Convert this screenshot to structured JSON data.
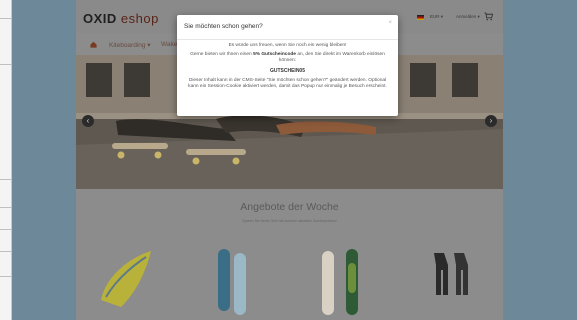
{
  "header": {
    "logo_left": "OXID",
    "logo_right": "eshop",
    "currency": "EUR",
    "account": "Anmelden"
  },
  "nav": {
    "items": [
      "Kiteboarding",
      "Wakeboarding"
    ]
  },
  "offers": {
    "title": "Angebote der Woche",
    "subtitle": "Sparen Sie heute Geld mit unseren aktuellen Sonderpreisen!"
  },
  "modal": {
    "title": "Sie möchten schon gehen?",
    "close": "×",
    "line1": "Es würde uns freuen, wenn Sie noch ein wenig bleiben!",
    "line2_pre": "Gerne bieten wir Ihnen einen ",
    "line2_bold": "5% Gutscheincode",
    "line2_post": " an, den Sie direkt im Warenkorb einlösen können:",
    "code": "GUTSCHEIN05",
    "note": "Dieser Inhalt kann in der CMS-Seite \"Sie möchten schon gehen?\" geändert werden. Optional kann ein Session-Cookie aktiviert werden, damit das Popup nur einmalig je Besuch erscheint."
  },
  "colors": {
    "side_panel": "#6d8898",
    "accent": "#5a2418",
    "overlay_page": "#8c8c8c"
  },
  "icons": {
    "home": "home-icon",
    "cart": "cart-icon",
    "flag": "flag-de-icon",
    "prev": "chevron-left-icon",
    "next": "chevron-right-icon"
  }
}
